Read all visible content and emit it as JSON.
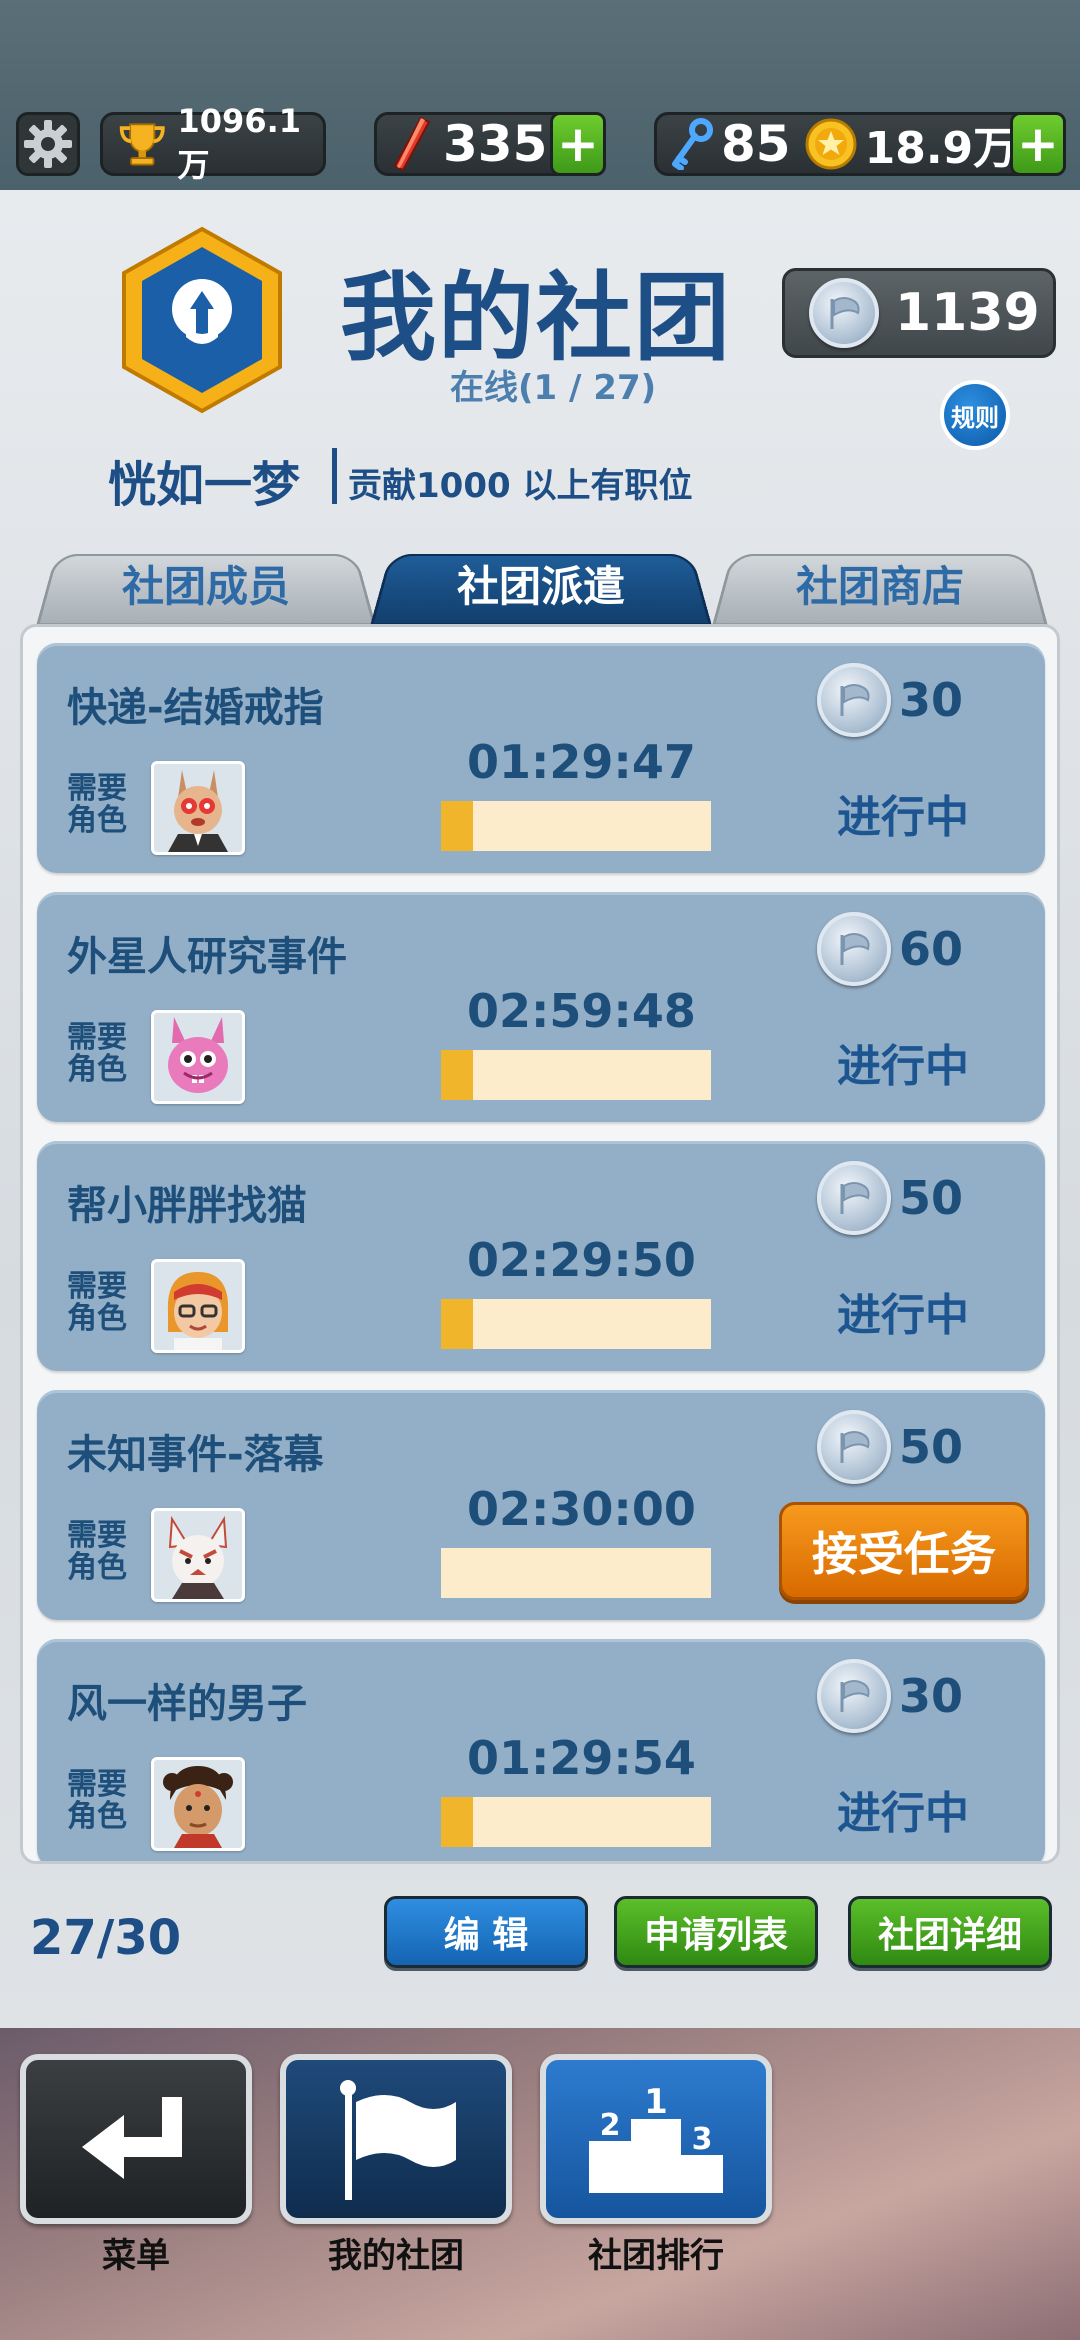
{
  "topbar": {
    "trophies": "1096.1万",
    "energy": "335",
    "keys": "85",
    "coins": "18.9万"
  },
  "header": {
    "title": "我的社团",
    "online": "在线(1 / 27)",
    "club_points": "1139",
    "rules_label": "规则",
    "username": "恍如一梦",
    "note": "贡献1000 以上有职位"
  },
  "tabs": [
    {
      "label": "社团成员",
      "active": false
    },
    {
      "label": "社团派遣",
      "active": true
    },
    {
      "label": "社团商店",
      "active": false
    }
  ],
  "missions": [
    {
      "title": "快递-结婚戒指",
      "req_label": "需要角色",
      "timer": "01:29:47",
      "progress": 0.12,
      "reward": "30",
      "status": "进行中"
    },
    {
      "title": "外星人研究事件",
      "req_label": "需要角色",
      "timer": "02:59:48",
      "progress": 0.12,
      "reward": "60",
      "status": "进行中"
    },
    {
      "title": "帮小胖胖找猫",
      "req_label": "需要角色",
      "timer": "02:29:50",
      "progress": 0.12,
      "reward": "50",
      "status": "进行中"
    },
    {
      "title": "未知事件-落幕",
      "req_label": "需要角色",
      "timer": "02:30:00",
      "progress": 0,
      "reward": "50",
      "status": "接受任务"
    },
    {
      "title": "风一样的男子",
      "req_label": "需要角色",
      "timer": "01:29:54",
      "progress": 0.12,
      "reward": "30",
      "status": "进行中"
    }
  ],
  "footer": {
    "count": "27/30",
    "edit_label": "编 辑",
    "apply_label": "申请列表",
    "detail_label": "社团详细"
  },
  "nav": {
    "menu_label": "菜单",
    "myclub_label": "我的社团",
    "ranking_label": "社团排行"
  },
  "colors": {
    "accent_blue": "#1e4e86",
    "card_bg": "#93afc7",
    "accept_orange": "#f08a10",
    "progress_fill": "#f1b52c"
  }
}
